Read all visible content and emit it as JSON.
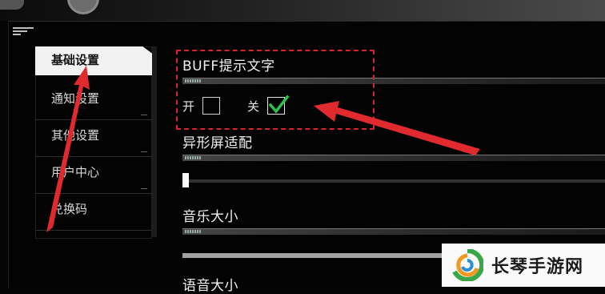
{
  "sidebar": {
    "items": [
      {
        "label": "基础设置",
        "active": true
      },
      {
        "label": "通知设置",
        "active": false
      },
      {
        "label": "其他设置",
        "active": false
      },
      {
        "label": "用户中心",
        "active": false
      },
      {
        "label": "兑换码",
        "active": false
      }
    ]
  },
  "settings": {
    "buff": {
      "title": "BUFF提示文字",
      "on_label": "开",
      "off_label": "关",
      "selected": "关"
    },
    "screen_adapt": {
      "title": "异形屏适配",
      "level": 0.0
    },
    "music_volume": {
      "title": "音乐大小"
    },
    "voice_volume": {
      "title": "语音大小"
    }
  },
  "watermark": {
    "text": "长琴手游网"
  },
  "colors": {
    "highlight_red": "#d8262a",
    "check_green": "#2fbf4a",
    "active_tab_bg": "#f2f2f2"
  }
}
